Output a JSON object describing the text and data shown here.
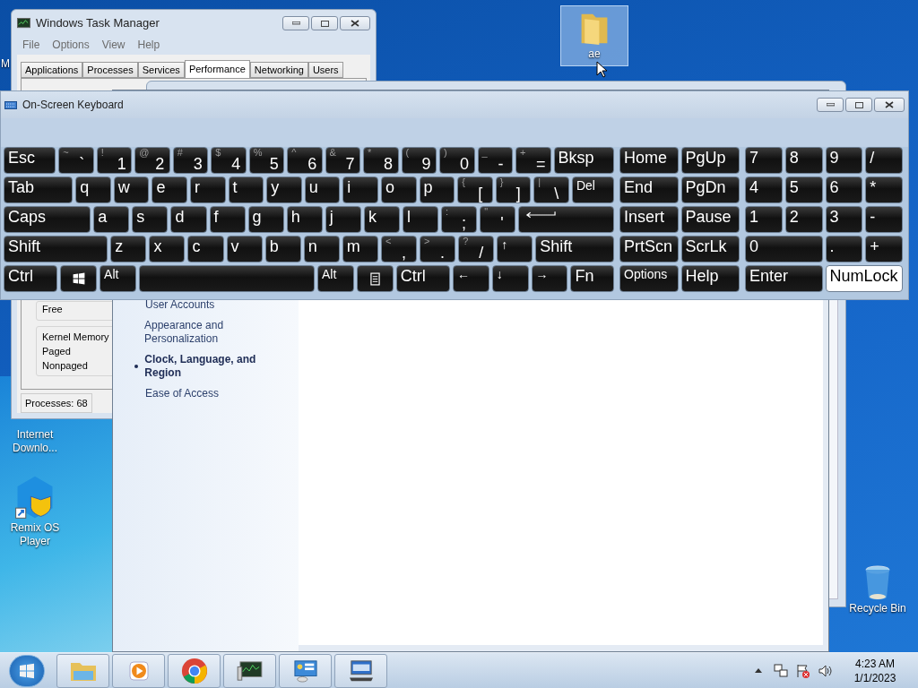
{
  "desktop_icons": [
    {
      "kind": "partial",
      "label": "M",
      "selected": false
    },
    {
      "kind": "folder",
      "label": "ae",
      "selected": true
    },
    {
      "kind": "hidden",
      "label": "Internet Downlo...",
      "selected": false
    },
    {
      "kind": "remix",
      "label": "Remix OS Player",
      "selected": false
    },
    {
      "kind": "recycle",
      "label": "Recycle Bin",
      "selected": false
    }
  ],
  "task_manager": {
    "title": "Windows Task Manager",
    "menu": [
      "File",
      "Options",
      "View",
      "Help"
    ],
    "tabs": [
      {
        "label": "Applications",
        "selected": false
      },
      {
        "label": "Processes",
        "selected": false
      },
      {
        "label": "Services",
        "selected": false
      },
      {
        "label": "Performance",
        "selected": true
      },
      {
        "label": "Networking",
        "selected": false
      },
      {
        "label": "Users",
        "selected": false
      }
    ],
    "physical_memory_rows": [
      "Free"
    ],
    "kernel_memory": {
      "title": "Kernel Memory",
      "rows": [
        "Paged",
        "Nonpaged"
      ]
    },
    "status": "Processes: 68"
  },
  "control_panel": {
    "sidebar": [
      {
        "label": "User Accounts",
        "selected": false
      },
      {
        "label": "Appearance and Personalization",
        "selected": false
      },
      {
        "label": "Clock, Language, and Region",
        "selected": true
      },
      {
        "label": "Ease of Access",
        "selected": false
      }
    ]
  },
  "keyboard": {
    "title": "On-Screen Keyboard",
    "main_rows": [
      [
        {
          "label": "Esc"
        },
        {
          "shift": "~",
          "label": "`"
        },
        {
          "shift": "!",
          "label": "1"
        },
        {
          "shift": "@",
          "label": "2"
        },
        {
          "shift": "#",
          "label": "3"
        },
        {
          "shift": "$",
          "label": "4"
        },
        {
          "shift": "%",
          "label": "5"
        },
        {
          "shift": "^",
          "label": "6"
        },
        {
          "shift": "&",
          "label": "7"
        },
        {
          "shift": "*",
          "label": "8"
        },
        {
          "shift": "(",
          "label": "9"
        },
        {
          "shift": ")",
          "label": "0"
        },
        {
          "shift": "_",
          "label": "-"
        },
        {
          "shift": "+",
          "label": "="
        },
        {
          "label": "Bksp"
        }
      ],
      [
        {
          "label": "Tab"
        },
        {
          "label": "q"
        },
        {
          "label": "w"
        },
        {
          "label": "e"
        },
        {
          "label": "r"
        },
        {
          "label": "t"
        },
        {
          "label": "y"
        },
        {
          "label": "u"
        },
        {
          "label": "i"
        },
        {
          "label": "o"
        },
        {
          "label": "p"
        },
        {
          "shift": "{",
          "label": "["
        },
        {
          "shift": "}",
          "label": "]"
        },
        {
          "shift": "|",
          "label": "\\"
        },
        {
          "label": "Del",
          "kind": "small"
        }
      ],
      [
        {
          "label": "Caps",
          "kind": "toggle",
          "on": false
        },
        {
          "label": "a"
        },
        {
          "label": "s"
        },
        {
          "label": "d"
        },
        {
          "label": "f"
        },
        {
          "label": "g"
        },
        {
          "label": "h"
        },
        {
          "label": "j"
        },
        {
          "label": "k"
        },
        {
          "label": "l"
        },
        {
          "shift": ":",
          "label": ";"
        },
        {
          "shift": "\"",
          "label": "'"
        },
        {
          "kind": "enter"
        }
      ],
      [
        {
          "label": "Shift"
        },
        {
          "label": "z"
        },
        {
          "label": "x"
        },
        {
          "label": "c"
        },
        {
          "label": "v"
        },
        {
          "label": "b"
        },
        {
          "label": "n"
        },
        {
          "label": "m"
        },
        {
          "shift": "<",
          "label": ","
        },
        {
          "shift": ">",
          "label": "."
        },
        {
          "shift": "?",
          "label": "/"
        },
        {
          "label": "↑",
          "kind": "small"
        },
        {
          "label": "Shift"
        }
      ],
      [
        {
          "label": "Ctrl"
        },
        {
          "kind": "win"
        },
        {
          "label": "Alt",
          "kind": "small"
        },
        {
          "kind": "space"
        },
        {
          "label": "Alt",
          "kind": "small"
        },
        {
          "kind": "menu"
        },
        {
          "label": "Ctrl"
        },
        {
          "label": "←",
          "kind": "small"
        },
        {
          "label": "↓",
          "kind": "small"
        },
        {
          "label": "→",
          "kind": "small"
        },
        {
          "label": "Fn"
        }
      ]
    ],
    "nav_rows": [
      [
        {
          "label": "Home"
        },
        {
          "label": "PgUp"
        }
      ],
      [
        {
          "label": "End"
        },
        {
          "label": "PgDn"
        }
      ],
      [
        {
          "label": "Insert"
        },
        {
          "label": "Pause"
        }
      ],
      [
        {
          "label": "PrtScn"
        },
        {
          "label": "ScrLk",
          "kind": "toggle",
          "on": false
        }
      ],
      [
        {
          "label": "Options",
          "kind": "small"
        },
        {
          "label": "Help"
        }
      ]
    ],
    "numpad_rows": [
      [
        {
          "label": "7"
        },
        {
          "label": "8"
        },
        {
          "label": "9"
        },
        {
          "label": "/"
        }
      ],
      [
        {
          "label": "4"
        },
        {
          "label": "5"
        },
        {
          "label": "6"
        },
        {
          "label": "*"
        }
      ],
      [
        {
          "label": "1"
        },
        {
          "label": "2"
        },
        {
          "label": "3"
        },
        {
          "label": "-"
        }
      ],
      [
        {
          "label": "0"
        },
        {
          "label": "."
        },
        {
          "label": "+"
        }
      ],
      [
        {
          "label": "Enter"
        },
        {
          "label": "NumLock",
          "kind": "toggle",
          "on": true
        }
      ]
    ]
  },
  "taskbar": {
    "time": "4:23 AM",
    "date": "1/1/2023"
  }
}
